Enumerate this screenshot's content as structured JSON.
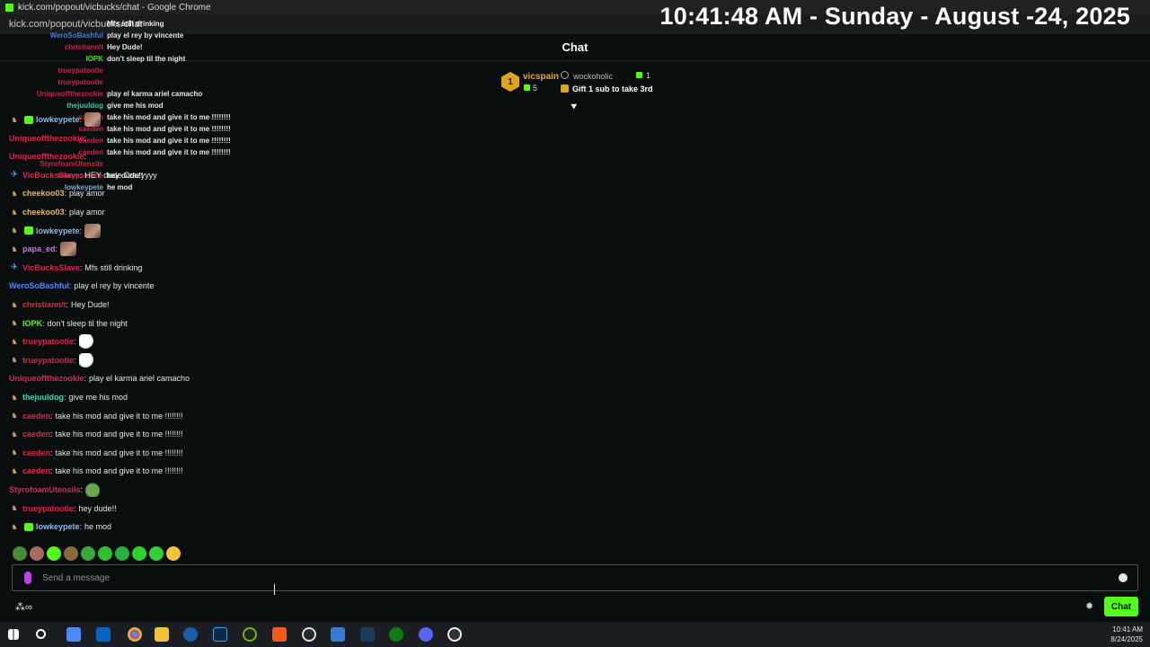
{
  "browser": {
    "title": "kick.com/popout/vicbucks/chat - Google Chrome",
    "url": "kick.com/popout/vicbucks/chat"
  },
  "clock_overlay": "10:41:48 AM - Sunday - August -24, 2025",
  "chat": {
    "header_title": "Chat",
    "leaderboard": {
      "rank": "1",
      "top_gifter_name": "vicspain",
      "top_gifter_count": "5",
      "second_name": "wockoholic",
      "second_count": "1",
      "gift_cta": "Gift 1 sub to take 3rd"
    },
    "messages": [
      {
        "user": "lowkeypete",
        "color": "#8fb9e8",
        "badges": [
          "og",
          "sub"
        ],
        "text": "",
        "emote": "photo"
      },
      {
        "user": "Uniqueoffthezookie",
        "color": "#e0244e",
        "badges": [],
        "text": "",
        "emote": ""
      },
      {
        "user": "Uniqueoffthezookie",
        "color": "#e0244e",
        "badges": [],
        "text": "",
        "emote": ""
      },
      {
        "user": "VicBucksSlave",
        "color": "#e0244e",
        "badges": [
          "vip"
        ],
        "text": "HEY dude Crazyyyy",
        "emote": ""
      },
      {
        "user": "cheekoo03",
        "color": "#e8b86a",
        "badges": [
          "og"
        ],
        "text": "play amor",
        "emote": ""
      },
      {
        "user": "cheekoo03",
        "color": "#e8b86a",
        "badges": [
          "og"
        ],
        "text": "play amor",
        "emote": ""
      },
      {
        "user": "lowkeypete",
        "color": "#8fb9e8",
        "badges": [
          "og",
          "sub"
        ],
        "text": "",
        "emote": "photo"
      },
      {
        "user": "papa_ed",
        "color": "#c678dd",
        "badges": [
          "og"
        ],
        "text": "",
        "emote": "photo"
      },
      {
        "user": "VicBucksSlave",
        "color": "#e0244e",
        "badges": [
          "vip"
        ],
        "text": "Mfs still drinking",
        "emote": ""
      },
      {
        "user": "WeroSoBashful",
        "color": "#4a8cff",
        "badges": [],
        "text": "play el rey by vincente",
        "emote": ""
      },
      {
        "user": "christiann/t",
        "color": "#e0244e",
        "badges": [
          "og"
        ],
        "text": "Hey Dude!",
        "emote": ""
      },
      {
        "user": "IOPK",
        "color": "#53fc18",
        "badges": [
          "og"
        ],
        "text": "don't sleep til the night",
        "emote": ""
      },
      {
        "user": "trueypatootie",
        "color": "#e0244e",
        "badges": [
          "og"
        ],
        "text": "",
        "emote": "face"
      },
      {
        "user": "trueypatootie",
        "color": "#e0244e",
        "badges": [
          "og"
        ],
        "text": "",
        "emote": "face"
      },
      {
        "user": "Uniqueoffthezookie",
        "color": "#e0244e",
        "badges": [],
        "text": "play el karma ariel camacho",
        "emote": ""
      },
      {
        "user": "thejuuldog",
        "color": "#3fd9b3",
        "badges": [
          "og"
        ],
        "text": "give me his mod",
        "emote": ""
      },
      {
        "user": "caeden",
        "color": "#e0244e",
        "badges": [
          "og"
        ],
        "text": "take his mod and give it to me !!!!!!!!",
        "emote": ""
      },
      {
        "user": "caeden",
        "color": "#e0244e",
        "badges": [
          "og"
        ],
        "text": "take his mod and give it to me !!!!!!!!",
        "emote": ""
      },
      {
        "user": "caeden",
        "color": "#e0244e",
        "badges": [
          "og"
        ],
        "text": "take his mod and give it to me !!!!!!!!",
        "emote": ""
      },
      {
        "user": "caeden",
        "color": "#e0244e",
        "badges": [
          "og"
        ],
        "text": "take his mod and give it to me !!!!!!!!",
        "emote": ""
      },
      {
        "user": "StyrofoamUtensils",
        "color": "#e0244e",
        "badges": [],
        "text": "",
        "emote": "frog"
      },
      {
        "user": "trueypatootie",
        "color": "#e0244e",
        "badges": [
          "og"
        ],
        "text": "hey dude!!",
        "emote": ""
      },
      {
        "user": "lowkeypete",
        "color": "#8fb9e8",
        "badges": [
          "og",
          "sub"
        ],
        "text": "he mod",
        "emote": ""
      }
    ],
    "ghost_overlay": [
      {
        "user": "",
        "color": "#ffffff",
        "text": "Mfs still drinking"
      },
      {
        "user": "WeroSoBashful",
        "color": "#4a8cff",
        "text": "play el rey by vincente"
      },
      {
        "user": "christiann/t",
        "color": "#e0244e",
        "text": "Hey Dude!"
      },
      {
        "user": "IOPK",
        "color": "#53fc18",
        "text": "don't sleep til the night"
      },
      {
        "user": "trueypatootie",
        "color": "#e0244e",
        "text": ""
      },
      {
        "user": "trueypatootie",
        "color": "#e0244e",
        "text": ""
      },
      {
        "user": "Uniqueoffthezookie",
        "color": "#e0244e",
        "text": "play el karma ariel camacho"
      },
      {
        "user": "thejuuldog",
        "color": "#3fd9b3",
        "text": "give me his mod"
      },
      {
        "user": "caeden",
        "color": "#e0244e",
        "text": "take his mod and give it to me !!!!!!!!"
      },
      {
        "user": "caeden",
        "color": "#e0244e",
        "text": "take his mod and give it to me !!!!!!!!"
      },
      {
        "user": "caeden",
        "color": "#e0244e",
        "text": "take his mod and give it to me !!!!!!!!"
      },
      {
        "user": "caeden",
        "color": "#e0244e",
        "text": "take his mod and give it to me !!!!!!!!"
      },
      {
        "user": "StyrofoamUtensils",
        "color": "#e0244e",
        "text": ""
      },
      {
        "user": "trueypatootie",
        "color": "#e0244e",
        "text": "hey dude!!"
      },
      {
        "user": "lowkeypete",
        "color": "#8fb9e8",
        "text": "he mod"
      }
    ],
    "input_placeholder": "Send a message",
    "send_label": "Chat"
  },
  "taskbar": {
    "time": "10:41 AM",
    "date": "8/24/2025"
  },
  "colors": {
    "kick_green": "#53fc18",
    "background": "#0b0e0f",
    "gold": "#e0a51a"
  }
}
